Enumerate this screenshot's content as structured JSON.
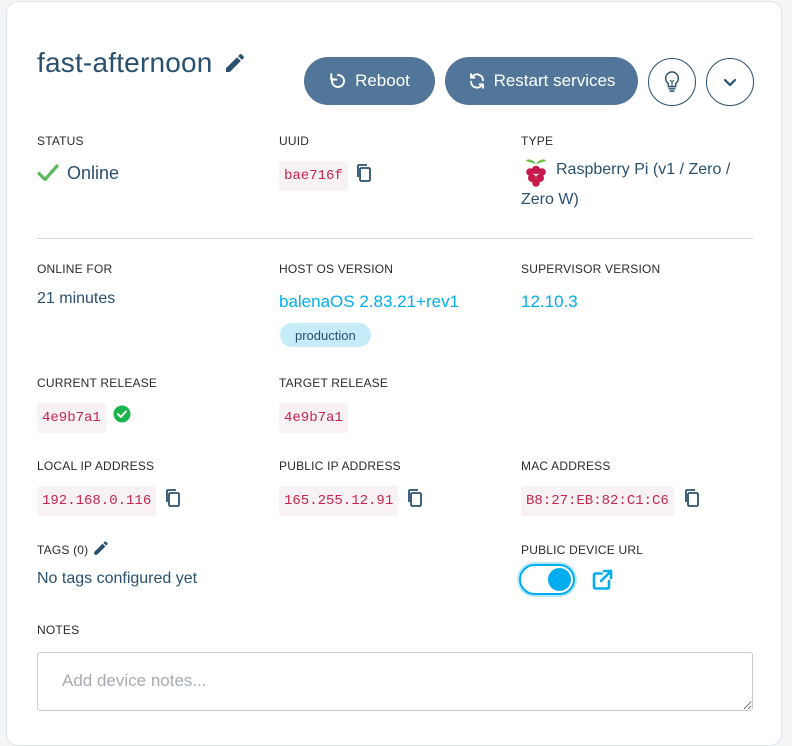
{
  "device": {
    "name": "fast-afternoon"
  },
  "actions": {
    "reboot_label": "Reboot",
    "restart_label": "Restart services"
  },
  "fields": {
    "status_label": "STATUS",
    "status_value": "Online",
    "uuid_label": "UUID",
    "uuid_value": "bae716f",
    "type_label": "TYPE",
    "type_value_line1": "Raspberry Pi (v1 / Zero /",
    "type_value_line2": "Zero W)",
    "online_for_label": "ONLINE FOR",
    "online_for_value": "21 minutes",
    "host_os_label": "HOST OS VERSION",
    "host_os_value": "balenaOS 2.83.21+rev1",
    "host_os_badge": "production",
    "supervisor_label": "SUPERVISOR VERSION",
    "supervisor_value": "12.10.3",
    "current_release_label": "CURRENT RELEASE",
    "current_release_value": "4e9b7a1",
    "target_release_label": "TARGET RELEASE",
    "target_release_value": "4e9b7a1",
    "local_ip_label": "LOCAL IP ADDRESS",
    "local_ip_value": "192.168.0.116",
    "public_ip_label": "PUBLIC IP ADDRESS",
    "public_ip_value": "165.255.12.91",
    "mac_label": "MAC ADDRESS",
    "mac_value": "B8:27:EB:82:C1:C6",
    "tags_label": "TAGS (0)",
    "tags_value": "No tags configured yet",
    "public_url_label": "PUBLIC DEVICE URL",
    "public_url_enabled": true,
    "notes_label": "NOTES",
    "notes_placeholder": "Add device notes..."
  },
  "colors": {
    "primary_button": "#527699",
    "text": "#2a506f",
    "link": "#00aeef",
    "online": "#5cb85c",
    "code_text": "#c7254e",
    "code_bg": "#f8f2f4",
    "badge_bg": "#c7ecf9",
    "release_ok": "#1bb34b"
  },
  "icons": {
    "edit": "pencil-icon",
    "reboot": "reboot-icon",
    "restart": "restart-icon",
    "lightbulb": "lightbulb-icon",
    "chevron": "chevron-down-icon",
    "status": "check-icon",
    "copy": "copy-icon",
    "device_type": "raspberry-pi-icon",
    "release_ok": "check-circle-icon",
    "external": "external-link-icon"
  }
}
